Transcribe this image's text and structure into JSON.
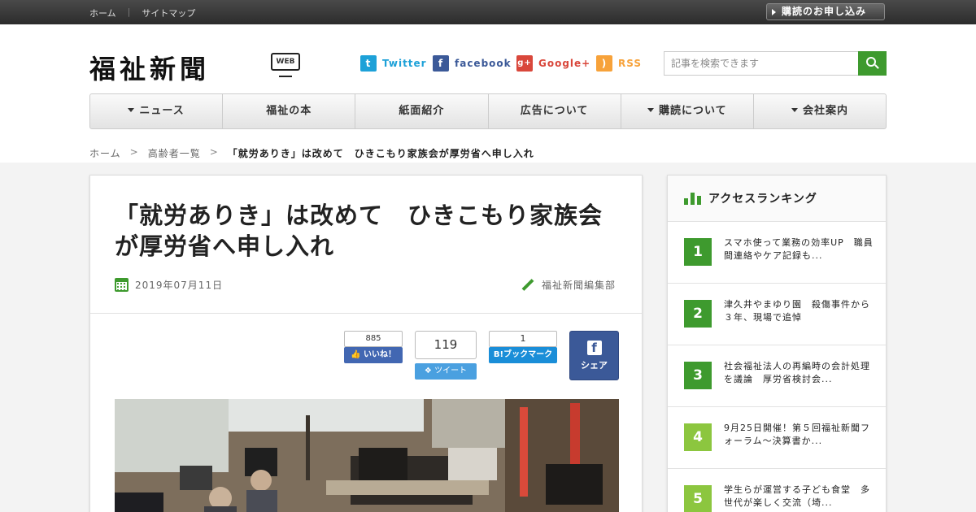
{
  "topbar": {
    "home_label": "ホーム",
    "sitemap_label": "サイトマップ",
    "subscribe_label": "購読のお申し込み"
  },
  "header": {
    "logo_text": "福祉新聞",
    "logo_badge": "WEB",
    "social": [
      {
        "icon": "twitter-icon",
        "label": "Twitter",
        "color": "#1da1d8",
        "glyph": "t"
      },
      {
        "icon": "facebook-icon",
        "label": "facebook",
        "color": "#3b5998",
        "glyph": "f"
      },
      {
        "icon": "google-plus-icon",
        "label": "Google+",
        "color": "#d9473b",
        "glyph": "g+"
      },
      {
        "icon": "rss-icon",
        "label": "RSS",
        "color": "#f7a23a",
        "glyph": ")"
      }
    ],
    "search_placeholder": "記事を検索できます"
  },
  "nav": {
    "items": [
      {
        "label": "ニュース",
        "dropdown": true
      },
      {
        "label": "福祉の本",
        "dropdown": false
      },
      {
        "label": "紙面紹介",
        "dropdown": false
      },
      {
        "label": "広告について",
        "dropdown": false
      },
      {
        "label": "購読について",
        "dropdown": true
      },
      {
        "label": "会社案内",
        "dropdown": true
      }
    ]
  },
  "breadcrumb": {
    "home": "ホーム",
    "category": "高齢者一覧",
    "current": "「就労ありき」は改めて　ひきこもり家族会が厚労省へ申し入れ"
  },
  "article": {
    "title": "「就労ありき」は改めて　ひきこもり家族会が厚労省へ申し入れ",
    "date": "2019年07月11日",
    "author": "福祉新聞編集部",
    "share": {
      "fb_like_count": "885",
      "fb_like_label": "いいね！",
      "tweet_count": "119",
      "tweet_label": "ツイート",
      "hatena_count": "1",
      "hatena_label": "B!ブックマーク",
      "fb_share_label": "シェア"
    }
  },
  "sidebar": {
    "title": "アクセスランキング",
    "accent_color": "#3e9a2e",
    "ranking": [
      {
        "rank": "1",
        "text": "スマホ使って業務の効率UP　職員間連絡やケア記録も...",
        "color": "#3e9a2e"
      },
      {
        "rank": "2",
        "text": "津久井やまゆり園　殺傷事件から３年、現場で追悼",
        "color": "#3e9a2e"
      },
      {
        "rank": "3",
        "text": "社会福祉法人の再編時の会計処理を議論　厚労省検討会...",
        "color": "#3e9a2e"
      },
      {
        "rank": "4",
        "text": "9月25日開催！第５回福祉新聞フォーラム～決算書か...",
        "color": "#8cc63f"
      },
      {
        "rank": "5",
        "text": "学生らが運営する子ども食堂　多世代が楽しく交流（埼...",
        "color": "#8cc63f"
      }
    ]
  }
}
